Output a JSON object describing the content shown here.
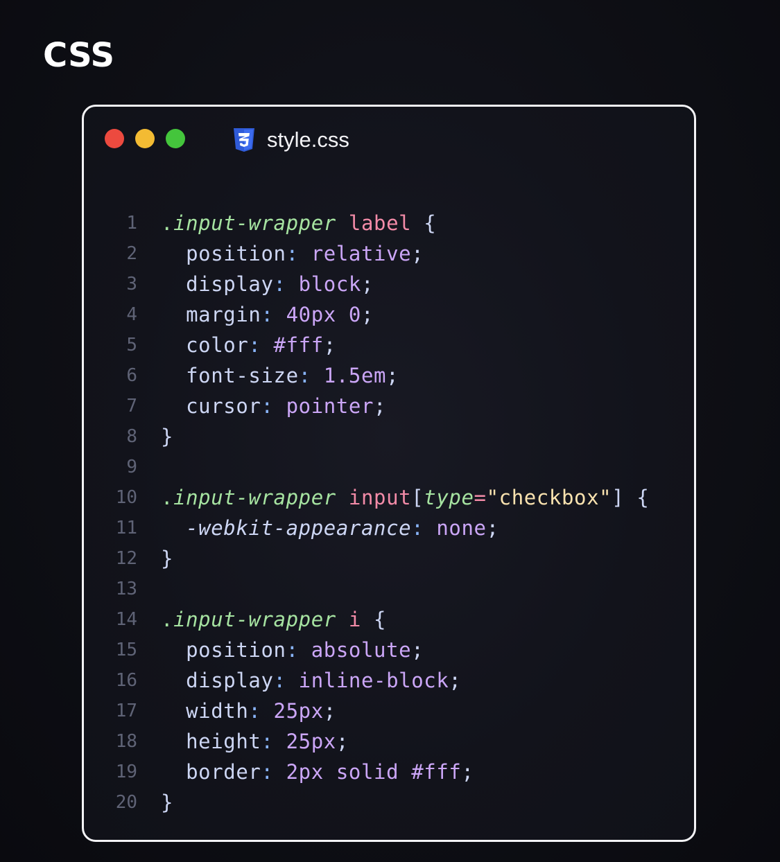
{
  "heading": "CSS",
  "window": {
    "traffic_lights": [
      {
        "name": "close",
        "color": "#ec4a3f"
      },
      {
        "name": "minimize",
        "color": "#f3bb33"
      },
      {
        "name": "maximize",
        "color": "#44c53c"
      }
    ],
    "file_icon": "css3-icon",
    "file_icon_color": "#2f5bd8",
    "file_name": "style.css"
  },
  "colors": {
    "selector": "#a6e3a1",
    "keyword": "#f38ba8",
    "property": "#cdd6f4",
    "value": "#cba6f7",
    "string": "#f9e2af",
    "punct": "#cdd6f4",
    "colon": "#89b4fa",
    "attr": "#a6e3a1",
    "line_number": "#5f6376"
  },
  "code_lines": [
    {
      "n": "1",
      "tokens": [
        {
          "t": ".",
          "c": "selector"
        },
        {
          "t": "input-wrapper",
          "c": "selector",
          "i": true
        },
        {
          "t": " ",
          "c": "punct"
        },
        {
          "t": "label",
          "c": "keyword"
        },
        {
          "t": " {",
          "c": "punct"
        }
      ]
    },
    {
      "n": "2",
      "tokens": [
        {
          "t": "  position",
          "c": "property"
        },
        {
          "t": ": ",
          "c": "colon"
        },
        {
          "t": "relative",
          "c": "value"
        },
        {
          "t": ";",
          "c": "punct"
        }
      ]
    },
    {
      "n": "3",
      "tokens": [
        {
          "t": "  display",
          "c": "property"
        },
        {
          "t": ": ",
          "c": "colon"
        },
        {
          "t": "block",
          "c": "value"
        },
        {
          "t": ";",
          "c": "punct"
        }
      ]
    },
    {
      "n": "4",
      "tokens": [
        {
          "t": "  margin",
          "c": "property"
        },
        {
          "t": ": ",
          "c": "colon"
        },
        {
          "t": "40px 0",
          "c": "value"
        },
        {
          "t": ";",
          "c": "punct"
        }
      ]
    },
    {
      "n": "5",
      "tokens": [
        {
          "t": "  color",
          "c": "property"
        },
        {
          "t": ": ",
          "c": "colon"
        },
        {
          "t": "#fff",
          "c": "value"
        },
        {
          "t": ";",
          "c": "punct"
        }
      ]
    },
    {
      "n": "6",
      "tokens": [
        {
          "t": "  font-size",
          "c": "property"
        },
        {
          "t": ": ",
          "c": "colon"
        },
        {
          "t": "1.5em",
          "c": "value"
        },
        {
          "t": ";",
          "c": "punct"
        }
      ]
    },
    {
      "n": "7",
      "tokens": [
        {
          "t": "  cursor",
          "c": "property"
        },
        {
          "t": ": ",
          "c": "colon"
        },
        {
          "t": "pointer",
          "c": "value"
        },
        {
          "t": ";",
          "c": "punct"
        }
      ]
    },
    {
      "n": "8",
      "tokens": [
        {
          "t": "}",
          "c": "punct"
        }
      ]
    },
    {
      "n": "9",
      "tokens": []
    },
    {
      "n": "10",
      "tokens": [
        {
          "t": ".",
          "c": "selector"
        },
        {
          "t": "input-wrapper",
          "c": "selector",
          "i": true
        },
        {
          "t": " ",
          "c": "punct"
        },
        {
          "t": "input",
          "c": "keyword"
        },
        {
          "t": "[",
          "c": "punct"
        },
        {
          "t": "type",
          "c": "attr",
          "i": true
        },
        {
          "t": "=",
          "c": "keyword"
        },
        {
          "t": "\"checkbox\"",
          "c": "string"
        },
        {
          "t": "] {",
          "c": "punct"
        }
      ]
    },
    {
      "n": "11",
      "tokens": [
        {
          "t": "  -webkit-appearance",
          "c": "property",
          "i": true
        },
        {
          "t": ": ",
          "c": "colon"
        },
        {
          "t": "none",
          "c": "value"
        },
        {
          "t": ";",
          "c": "punct"
        }
      ]
    },
    {
      "n": "12",
      "tokens": [
        {
          "t": "}",
          "c": "punct"
        }
      ]
    },
    {
      "n": "13",
      "tokens": []
    },
    {
      "n": "14",
      "tokens": [
        {
          "t": ".",
          "c": "selector"
        },
        {
          "t": "input-wrapper",
          "c": "selector",
          "i": true
        },
        {
          "t": " ",
          "c": "punct"
        },
        {
          "t": "i",
          "c": "keyword"
        },
        {
          "t": " {",
          "c": "punct"
        }
      ]
    },
    {
      "n": "15",
      "tokens": [
        {
          "t": "  position",
          "c": "property"
        },
        {
          "t": ": ",
          "c": "colon"
        },
        {
          "t": "absolute",
          "c": "value"
        },
        {
          "t": ";",
          "c": "punct"
        }
      ]
    },
    {
      "n": "16",
      "tokens": [
        {
          "t": "  display",
          "c": "property"
        },
        {
          "t": ": ",
          "c": "colon"
        },
        {
          "t": "inline-block",
          "c": "value"
        },
        {
          "t": ";",
          "c": "punct"
        }
      ]
    },
    {
      "n": "17",
      "tokens": [
        {
          "t": "  width",
          "c": "property"
        },
        {
          "t": ": ",
          "c": "colon"
        },
        {
          "t": "25px",
          "c": "value"
        },
        {
          "t": ";",
          "c": "punct"
        }
      ]
    },
    {
      "n": "18",
      "tokens": [
        {
          "t": "  height",
          "c": "property"
        },
        {
          "t": ": ",
          "c": "colon"
        },
        {
          "t": "25px",
          "c": "value"
        },
        {
          "t": ";",
          "c": "punct"
        }
      ]
    },
    {
      "n": "19",
      "tokens": [
        {
          "t": "  border",
          "c": "property"
        },
        {
          "t": ": ",
          "c": "colon"
        },
        {
          "t": "2px solid #fff",
          "c": "value"
        },
        {
          "t": ";",
          "c": "punct"
        }
      ]
    },
    {
      "n": "20",
      "tokens": [
        {
          "t": "}",
          "c": "punct"
        }
      ]
    }
  ]
}
